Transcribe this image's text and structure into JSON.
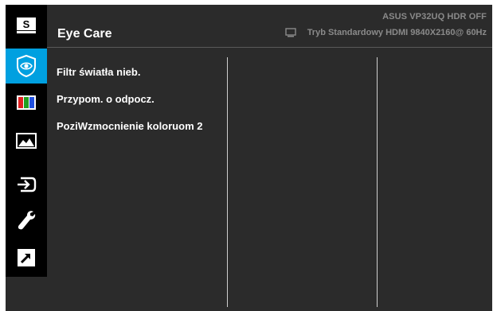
{
  "header": {
    "title": "Eye Care",
    "model": "ASUS  VP32UQ  HDR OFF",
    "status": "Tryb Standardowy HDMI 9840X2160@ 60Hz"
  },
  "sidebar": {
    "items": [
      {
        "icon": "splendid-s-icon",
        "label": "S"
      },
      {
        "icon": "eye-care-icon",
        "active": true
      },
      {
        "icon": "color-bars-icon"
      },
      {
        "icon": "image-icon"
      },
      {
        "icon": "input-select-icon"
      },
      {
        "icon": "system-setup-wrench-icon"
      },
      {
        "icon": "shortcut-arrow-icon"
      }
    ]
  },
  "menu": {
    "items": [
      "Filtr światła nieb.",
      "Przypom. o odpocz.",
      "PoziWzmocnienie koloruom 2"
    ]
  },
  "colors": {
    "background": "#2b2b2b",
    "sidebar": "#000000",
    "accent": "#00a0e0",
    "text": "#ffffff",
    "muted_text": "#8a8a8a"
  }
}
